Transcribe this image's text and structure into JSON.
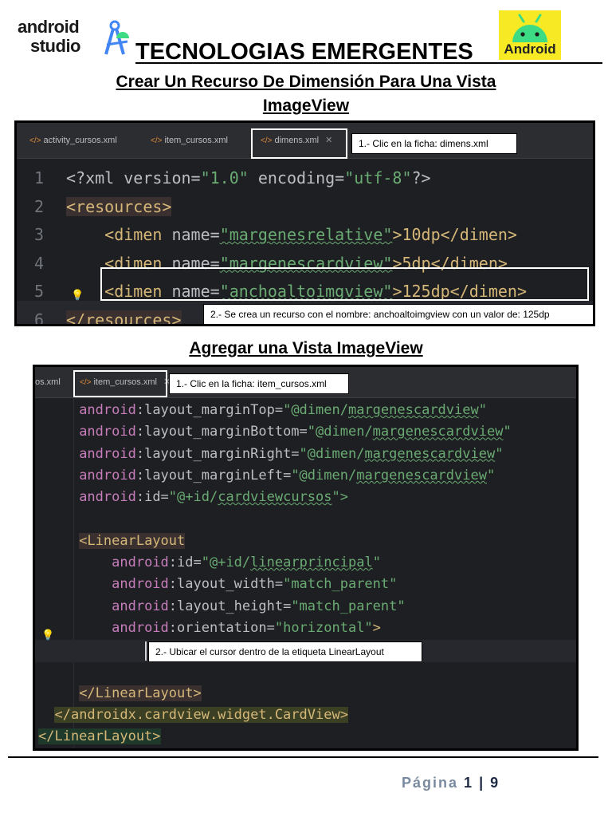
{
  "header": {
    "logo_left_line1": "android",
    "logo_left_line2": "studio",
    "title": "TECNOLOGIAS EMERGENTES",
    "logo_right_label": "Android"
  },
  "section1": {
    "title_line1": "Crear Un Recurso De Dimensión Para Una Vista",
    "title_line2": "ImageView",
    "tabs": [
      "activity_cursos.xml",
      "item_cursos.xml",
      "dimens.xml"
    ],
    "callout1": "1.- Clic en la ficha: dimens.xml",
    "callout2": "2.- Se crea un recurso con el nombre: anchoaltoimgview con un valor de: 125dp",
    "line_numbers": [
      "1",
      "2",
      "3",
      "4",
      "5",
      "6"
    ],
    "code": {
      "l1_a": "<?xml version=",
      "l1_b": "\"1.0\"",
      "l1_c": " encoding=",
      "l1_d": "\"utf-8\"",
      "l1_e": "?>",
      "l2": "<resources>",
      "dimen_open": "<dimen ",
      "name_attr": "name=",
      "l3_val": "\"margenesrelative\"",
      "l3_rest": ">10dp</dimen>",
      "l4_val": "\"margenescardview\"",
      "l4_rest": ">5dp</dimen>",
      "l5_val": "\"anchoaltoimgview\"",
      "l5_rest": ">125dp</dimen>",
      "l6": "</resources>"
    }
  },
  "section2": {
    "title": "Agregar una Vista ImageView",
    "tabs": [
      "os.xml",
      "item_cursos.xml"
    ],
    "callout1": "1.- Clic en la ficha: item_cursos.xml",
    "callout2": "2.- Ubicar el cursor dentro de la etiqueta LinearLayout",
    "code": {
      "android": "android",
      "r1_attr": ":layout_marginTop=",
      "r2_attr": ":layout_marginBottom=",
      "r3_attr": ":layout_marginRight=",
      "r4_attr": ":layout_marginLeft=",
      "dimen_prefix": "\"@dimen/",
      "dimen_name": "margenescardview",
      "quote": "\"",
      "r5_attr": ":id=",
      "r5_val_pre": "\"@+id/",
      "r5_val_name": "cardviewcursos",
      "r5_end": "\">",
      "r6": "<LinearLayout",
      "r7_attr": ":id=",
      "r7_val_pre": "\"@+id/",
      "r7_val_name": "linearprincipal",
      "r8_attr": ":layout_width=",
      "r8_val": "\"match_parent\"",
      "r9_attr": ":layout_height=",
      "r9_val": "\"match_parent\"",
      "r10_attr": ":orientation=",
      "r10_val": "\"horizontal\"",
      "r10_end": ">",
      "r11": "</LinearLayout>",
      "r12": "</androidx.cardview.widget.CardView>",
      "r13": "</LinearLayout>"
    }
  },
  "footer": {
    "label": "Página",
    "page": "1",
    "sep": "|",
    "total": "9"
  },
  "colors": {
    "editor_bg": "#1e1f22",
    "attr": "#c77dbb",
    "value": "#6aab73",
    "tag": "#d5b778",
    "android_yellow": "#f7ea25",
    "android_green": "#3ddc84"
  }
}
